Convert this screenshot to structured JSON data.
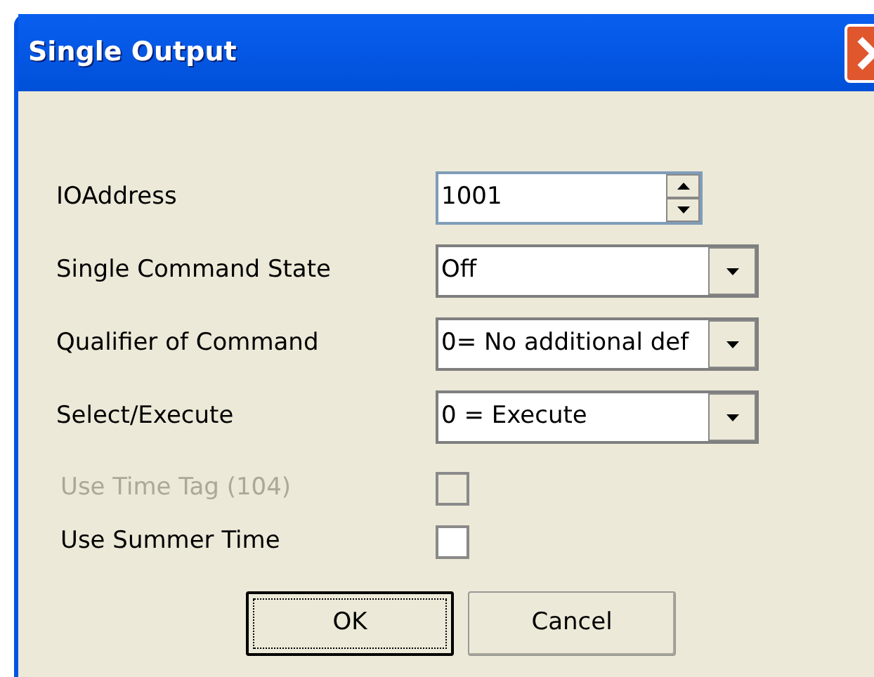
{
  "window": {
    "title": "Single Output"
  },
  "fields": [
    {
      "kind": "spin",
      "label": "IOAddress",
      "value": "1001"
    },
    {
      "kind": "combo",
      "label": "Single Command State",
      "value": "Off"
    },
    {
      "kind": "combo",
      "label": "Qualifier of Command",
      "value": "0= No additional def"
    },
    {
      "kind": "combo",
      "label": "Select/Execute",
      "value": "0 = Execute"
    }
  ],
  "checkboxes": [
    {
      "label": "Use Time Tag (104)",
      "checked": false,
      "disabled": true
    },
    {
      "label": "Use Summer Time",
      "checked": false,
      "disabled": false
    }
  ],
  "buttons": [
    {
      "label": "OK",
      "default": true
    },
    {
      "label": "Cancel",
      "default": false
    }
  ]
}
